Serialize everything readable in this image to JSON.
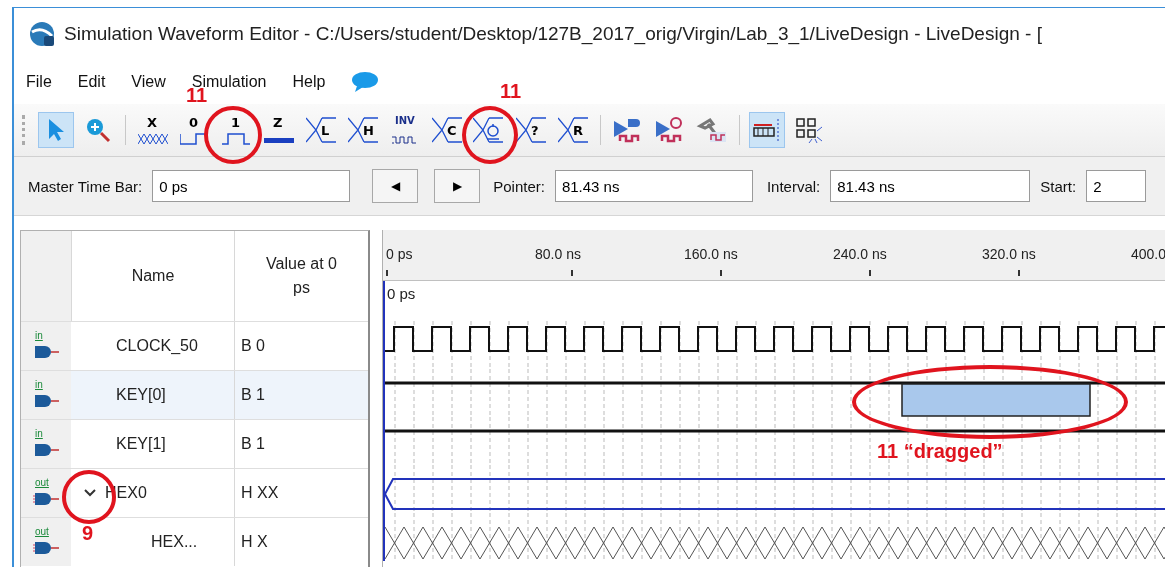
{
  "window": {
    "title": "Simulation Waveform Editor - C:/Users/student/Desktop/127B_2017_orig/Virgin/Lab_3_1/LiveDesign - LiveDesign - ["
  },
  "menu": [
    "File",
    "Edit",
    "View",
    "Simulation",
    "Help"
  ],
  "toolbar": [
    {
      "kind": "pointer",
      "selected": true
    },
    {
      "kind": "zoom",
      "selected": false
    },
    {
      "kind": "sep"
    },
    {
      "kind": "hatch",
      "label": "X",
      "selected": false
    },
    {
      "kind": "low",
      "label": "0",
      "selected": false
    },
    {
      "kind": "high",
      "label": "1",
      "selected": false
    },
    {
      "kind": "bar",
      "label": "Z",
      "selected": false
    },
    {
      "kind": "trans",
      "label": "L",
      "selected": false
    },
    {
      "kind": "trans",
      "label": "H",
      "selected": false
    },
    {
      "kind": "invert",
      "label": "INV",
      "selected": false
    },
    {
      "kind": "trans",
      "label": "C",
      "selected": false
    },
    {
      "kind": "clock",
      "selected": false
    },
    {
      "kind": "trans",
      "label": "?",
      "selected": false
    },
    {
      "kind": "trans",
      "label": "R",
      "selected": false
    },
    {
      "kind": "sep"
    },
    {
      "kind": "run",
      "selected": false
    },
    {
      "kind": "runtimer",
      "selected": false
    },
    {
      "kind": "hammer",
      "selected": false
    },
    {
      "kind": "sep"
    },
    {
      "kind": "snap",
      "selected": true
    },
    {
      "kind": "grid",
      "selected": false
    }
  ],
  "time_bar": {
    "master_label": "Master Time Bar:",
    "master_value": "0 ps",
    "prev": "◀",
    "next": "▶",
    "pointer_label": "Pointer:",
    "pointer_value": "81.43 ns",
    "interval_label": "Interval:",
    "interval_value": "81.43 ns",
    "start_label": "Start:",
    "start_value": "2"
  },
  "columns": {
    "name": "Name",
    "value": "Value at 0 ps"
  },
  "ruler": [
    "0 ps",
    "80.0 ns",
    "160.0 ns",
    "240.0 ns",
    "320.0 ns",
    "400.0"
  ],
  "cursor_label": "0 ps",
  "signals": [
    {
      "direction": "in",
      "name": "CLOCK_50",
      "value": "B 0",
      "kind": "clock",
      "selected": false
    },
    {
      "direction": "in",
      "name": "KEY[0]",
      "value": "B 1",
      "kind": "high",
      "selected": true
    },
    {
      "direction": "in",
      "name": "KEY[1]",
      "value": "B 1",
      "kind": "high",
      "selected": false
    },
    {
      "direction": "out",
      "name": "HEX0",
      "value": "H XX",
      "kind": "bus",
      "selected": false,
      "expanded": true,
      "children": [
        {
          "direction": "out",
          "name": "HEX...",
          "value": "H X",
          "kind": "unknown",
          "selected": false
        }
      ]
    }
  ],
  "annotations": [
    "11",
    "11",
    "11 “dragged”",
    "9"
  ]
}
